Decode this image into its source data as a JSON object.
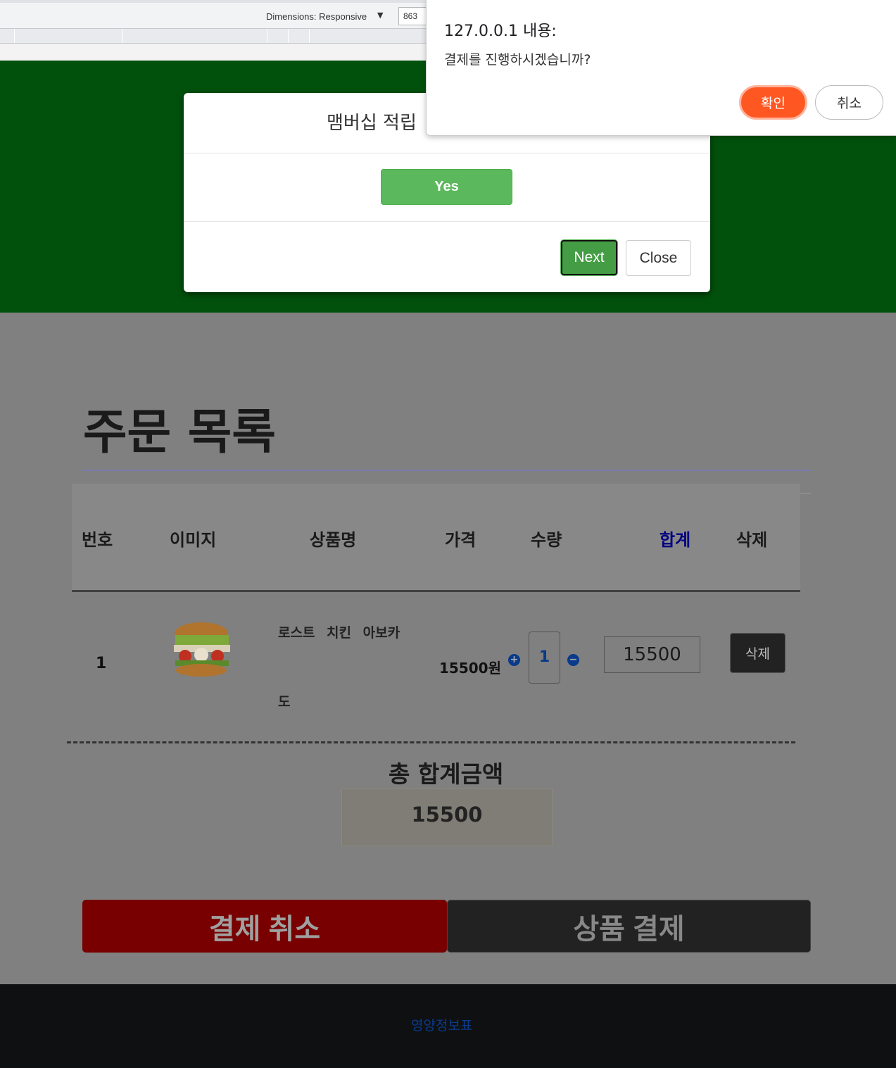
{
  "devtools": {
    "dimensions_label": "Dimensions: Responsive",
    "dimensions_arrow": "▼",
    "width_value": "863"
  },
  "modal": {
    "title": "맴버십 적립",
    "yes_label": "Yes",
    "next_label": "Next",
    "close_label": "Close"
  },
  "confirm": {
    "title": "127.0.0.1 내용:",
    "message": "결제를 진행하시겠습니까?",
    "ok_label": "확인",
    "cancel_label": "취소"
  },
  "order": {
    "title": "주문 목록",
    "headers": [
      "번호",
      "이미지",
      "상품명",
      "가격",
      "수량",
      "합계",
      "삭제"
    ],
    "row": {
      "num": "1",
      "name_line1": "로스트 치킨 아보카",
      "name_line2": "도",
      "price": "15500원",
      "qty": "1",
      "plus": "+",
      "minus": "−",
      "total": "15500",
      "delete_label": "삭제"
    },
    "grand_total_label": "총 합계금액",
    "grand_total_value": "15500",
    "cancel_payment_label": "결제 취소",
    "pay_label": "상품 결제"
  },
  "footer": {
    "link": "영양정보표"
  },
  "colors": {
    "header_green": "#01510c",
    "confirm_ok": "#ff5722",
    "yes_green": "#5cb85c",
    "cancel_red": "#780000"
  }
}
